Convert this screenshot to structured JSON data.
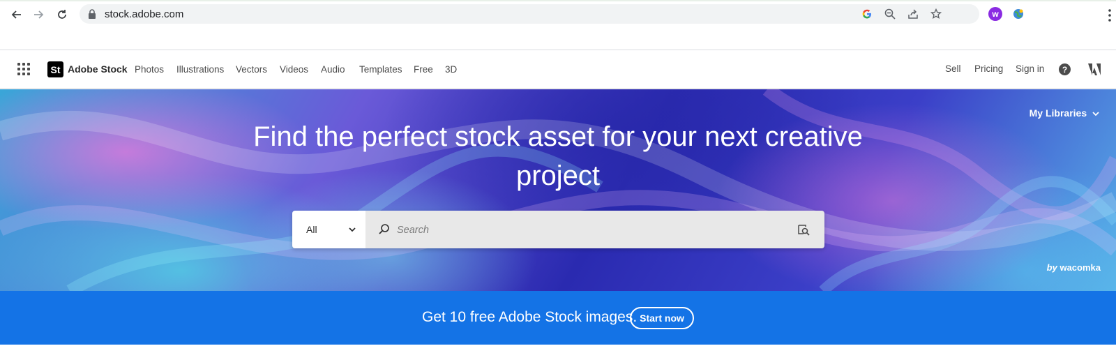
{
  "browser": {
    "url": "stock.adobe.com"
  },
  "header": {
    "logo_text": "St",
    "brand": "Adobe Stock",
    "nav": [
      "Photos",
      "Illustrations",
      "Vectors",
      "Videos",
      "Audio",
      "Templates",
      "Free",
      "3D"
    ],
    "right_links": [
      "Sell",
      "Pricing",
      "Sign in"
    ],
    "help_label": "?"
  },
  "hero": {
    "my_libraries": "My Libraries",
    "title_line1": "Find the perfect stock asset for your next creative",
    "title_line2": "project",
    "search": {
      "type_selected": "All",
      "placeholder": "Search"
    },
    "credit_by": "by",
    "credit_name": "wacomka"
  },
  "promo": {
    "text": "Get 10 free Adobe Stock images.",
    "button": "Start now"
  },
  "colors": {
    "promo_blue": "#1473e6",
    "ext_purple": "#8a2be2"
  }
}
